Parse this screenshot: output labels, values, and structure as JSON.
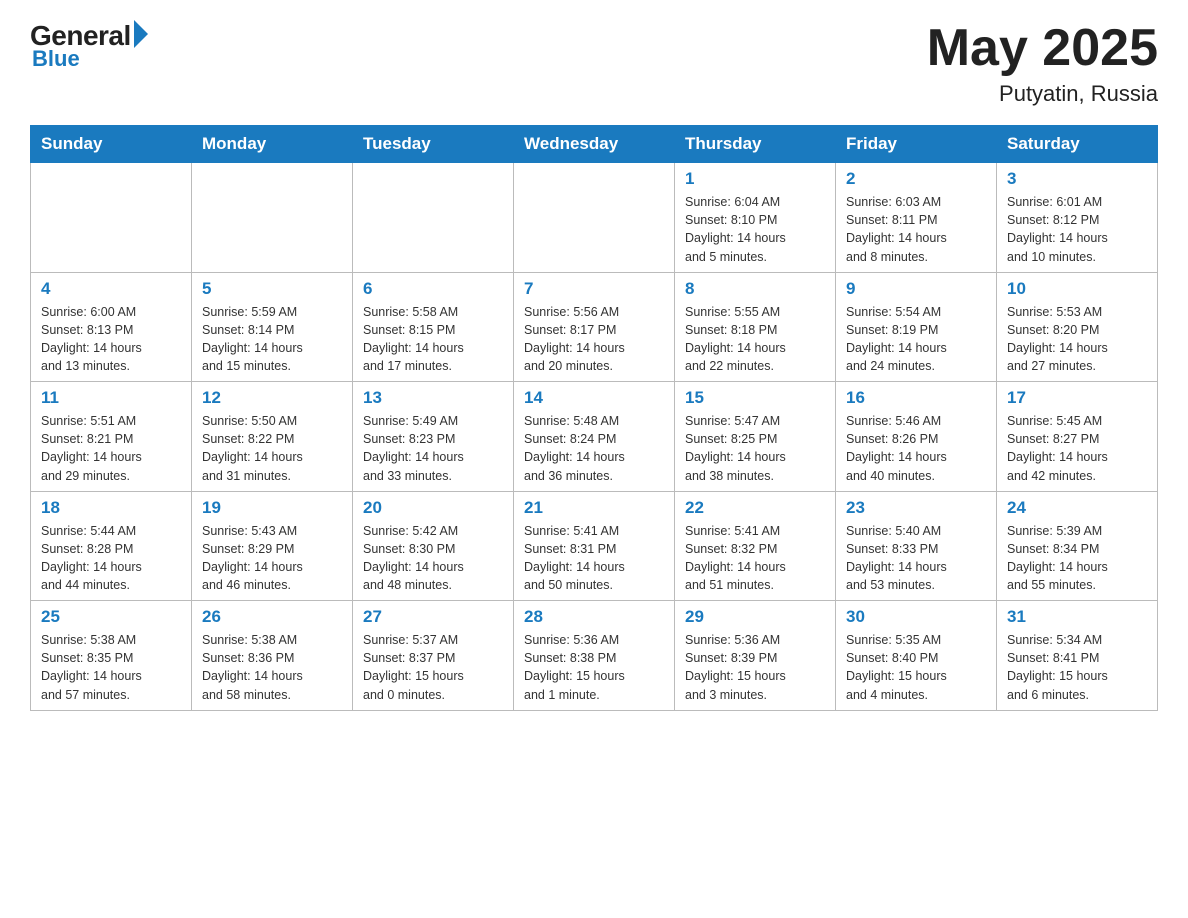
{
  "header": {
    "logo": {
      "general": "General",
      "blue": "Blue"
    },
    "title": "May 2025",
    "location": "Putyatin, Russia"
  },
  "calendar": {
    "days_of_week": [
      "Sunday",
      "Monday",
      "Tuesday",
      "Wednesday",
      "Thursday",
      "Friday",
      "Saturday"
    ],
    "weeks": [
      [
        {
          "day": "",
          "info": ""
        },
        {
          "day": "",
          "info": ""
        },
        {
          "day": "",
          "info": ""
        },
        {
          "day": "",
          "info": ""
        },
        {
          "day": "1",
          "info": "Sunrise: 6:04 AM\nSunset: 8:10 PM\nDaylight: 14 hours\nand 5 minutes."
        },
        {
          "day": "2",
          "info": "Sunrise: 6:03 AM\nSunset: 8:11 PM\nDaylight: 14 hours\nand 8 minutes."
        },
        {
          "day": "3",
          "info": "Sunrise: 6:01 AM\nSunset: 8:12 PM\nDaylight: 14 hours\nand 10 minutes."
        }
      ],
      [
        {
          "day": "4",
          "info": "Sunrise: 6:00 AM\nSunset: 8:13 PM\nDaylight: 14 hours\nand 13 minutes."
        },
        {
          "day": "5",
          "info": "Sunrise: 5:59 AM\nSunset: 8:14 PM\nDaylight: 14 hours\nand 15 minutes."
        },
        {
          "day": "6",
          "info": "Sunrise: 5:58 AM\nSunset: 8:15 PM\nDaylight: 14 hours\nand 17 minutes."
        },
        {
          "day": "7",
          "info": "Sunrise: 5:56 AM\nSunset: 8:17 PM\nDaylight: 14 hours\nand 20 minutes."
        },
        {
          "day": "8",
          "info": "Sunrise: 5:55 AM\nSunset: 8:18 PM\nDaylight: 14 hours\nand 22 minutes."
        },
        {
          "day": "9",
          "info": "Sunrise: 5:54 AM\nSunset: 8:19 PM\nDaylight: 14 hours\nand 24 minutes."
        },
        {
          "day": "10",
          "info": "Sunrise: 5:53 AM\nSunset: 8:20 PM\nDaylight: 14 hours\nand 27 minutes."
        }
      ],
      [
        {
          "day": "11",
          "info": "Sunrise: 5:51 AM\nSunset: 8:21 PM\nDaylight: 14 hours\nand 29 minutes."
        },
        {
          "day": "12",
          "info": "Sunrise: 5:50 AM\nSunset: 8:22 PM\nDaylight: 14 hours\nand 31 minutes."
        },
        {
          "day": "13",
          "info": "Sunrise: 5:49 AM\nSunset: 8:23 PM\nDaylight: 14 hours\nand 33 minutes."
        },
        {
          "day": "14",
          "info": "Sunrise: 5:48 AM\nSunset: 8:24 PM\nDaylight: 14 hours\nand 36 minutes."
        },
        {
          "day": "15",
          "info": "Sunrise: 5:47 AM\nSunset: 8:25 PM\nDaylight: 14 hours\nand 38 minutes."
        },
        {
          "day": "16",
          "info": "Sunrise: 5:46 AM\nSunset: 8:26 PM\nDaylight: 14 hours\nand 40 minutes."
        },
        {
          "day": "17",
          "info": "Sunrise: 5:45 AM\nSunset: 8:27 PM\nDaylight: 14 hours\nand 42 minutes."
        }
      ],
      [
        {
          "day": "18",
          "info": "Sunrise: 5:44 AM\nSunset: 8:28 PM\nDaylight: 14 hours\nand 44 minutes."
        },
        {
          "day": "19",
          "info": "Sunrise: 5:43 AM\nSunset: 8:29 PM\nDaylight: 14 hours\nand 46 minutes."
        },
        {
          "day": "20",
          "info": "Sunrise: 5:42 AM\nSunset: 8:30 PM\nDaylight: 14 hours\nand 48 minutes."
        },
        {
          "day": "21",
          "info": "Sunrise: 5:41 AM\nSunset: 8:31 PM\nDaylight: 14 hours\nand 50 minutes."
        },
        {
          "day": "22",
          "info": "Sunrise: 5:41 AM\nSunset: 8:32 PM\nDaylight: 14 hours\nand 51 minutes."
        },
        {
          "day": "23",
          "info": "Sunrise: 5:40 AM\nSunset: 8:33 PM\nDaylight: 14 hours\nand 53 minutes."
        },
        {
          "day": "24",
          "info": "Sunrise: 5:39 AM\nSunset: 8:34 PM\nDaylight: 14 hours\nand 55 minutes."
        }
      ],
      [
        {
          "day": "25",
          "info": "Sunrise: 5:38 AM\nSunset: 8:35 PM\nDaylight: 14 hours\nand 57 minutes."
        },
        {
          "day": "26",
          "info": "Sunrise: 5:38 AM\nSunset: 8:36 PM\nDaylight: 14 hours\nand 58 minutes."
        },
        {
          "day": "27",
          "info": "Sunrise: 5:37 AM\nSunset: 8:37 PM\nDaylight: 15 hours\nand 0 minutes."
        },
        {
          "day": "28",
          "info": "Sunrise: 5:36 AM\nSunset: 8:38 PM\nDaylight: 15 hours\nand 1 minute."
        },
        {
          "day": "29",
          "info": "Sunrise: 5:36 AM\nSunset: 8:39 PM\nDaylight: 15 hours\nand 3 minutes."
        },
        {
          "day": "30",
          "info": "Sunrise: 5:35 AM\nSunset: 8:40 PM\nDaylight: 15 hours\nand 4 minutes."
        },
        {
          "day": "31",
          "info": "Sunrise: 5:34 AM\nSunset: 8:41 PM\nDaylight: 15 hours\nand 6 minutes."
        }
      ]
    ]
  }
}
